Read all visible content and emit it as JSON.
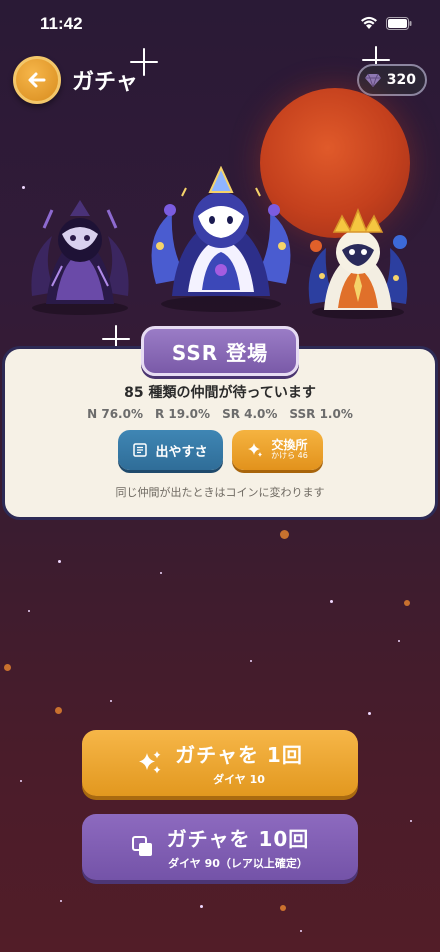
{
  "status_bar": {
    "time": "11:42"
  },
  "header": {
    "title": "ガチャ",
    "currency": {
      "icon": "gem-icon",
      "amount": "320"
    }
  },
  "banner": {
    "tab_label": "SSR 登場",
    "headline": "85 種類の仲間が待っています",
    "rates": [
      "N 76.0%",
      "R 19.0%",
      "SR 4.0%",
      "SSR 1.0%"
    ],
    "odds_button": {
      "icon": "list-icon",
      "label": "出やすさ"
    },
    "exchange_button": {
      "icon": "sparkle-icon",
      "label": "交換所",
      "sub": "かけら 46"
    },
    "note": "同じ仲間が出たときはコインに変わります"
  },
  "actions": {
    "single": {
      "icon": "sparkles-icon",
      "label": "ガチャを 1回",
      "cost": "ダイヤ 10",
      "color": "#F0A83A"
    },
    "multi": {
      "icon": "stacked-cards-icon",
      "label": "ガチャを 10回",
      "cost": "ダイヤ 90（レア以上確定）",
      "color": "#7E5CB2"
    }
  }
}
